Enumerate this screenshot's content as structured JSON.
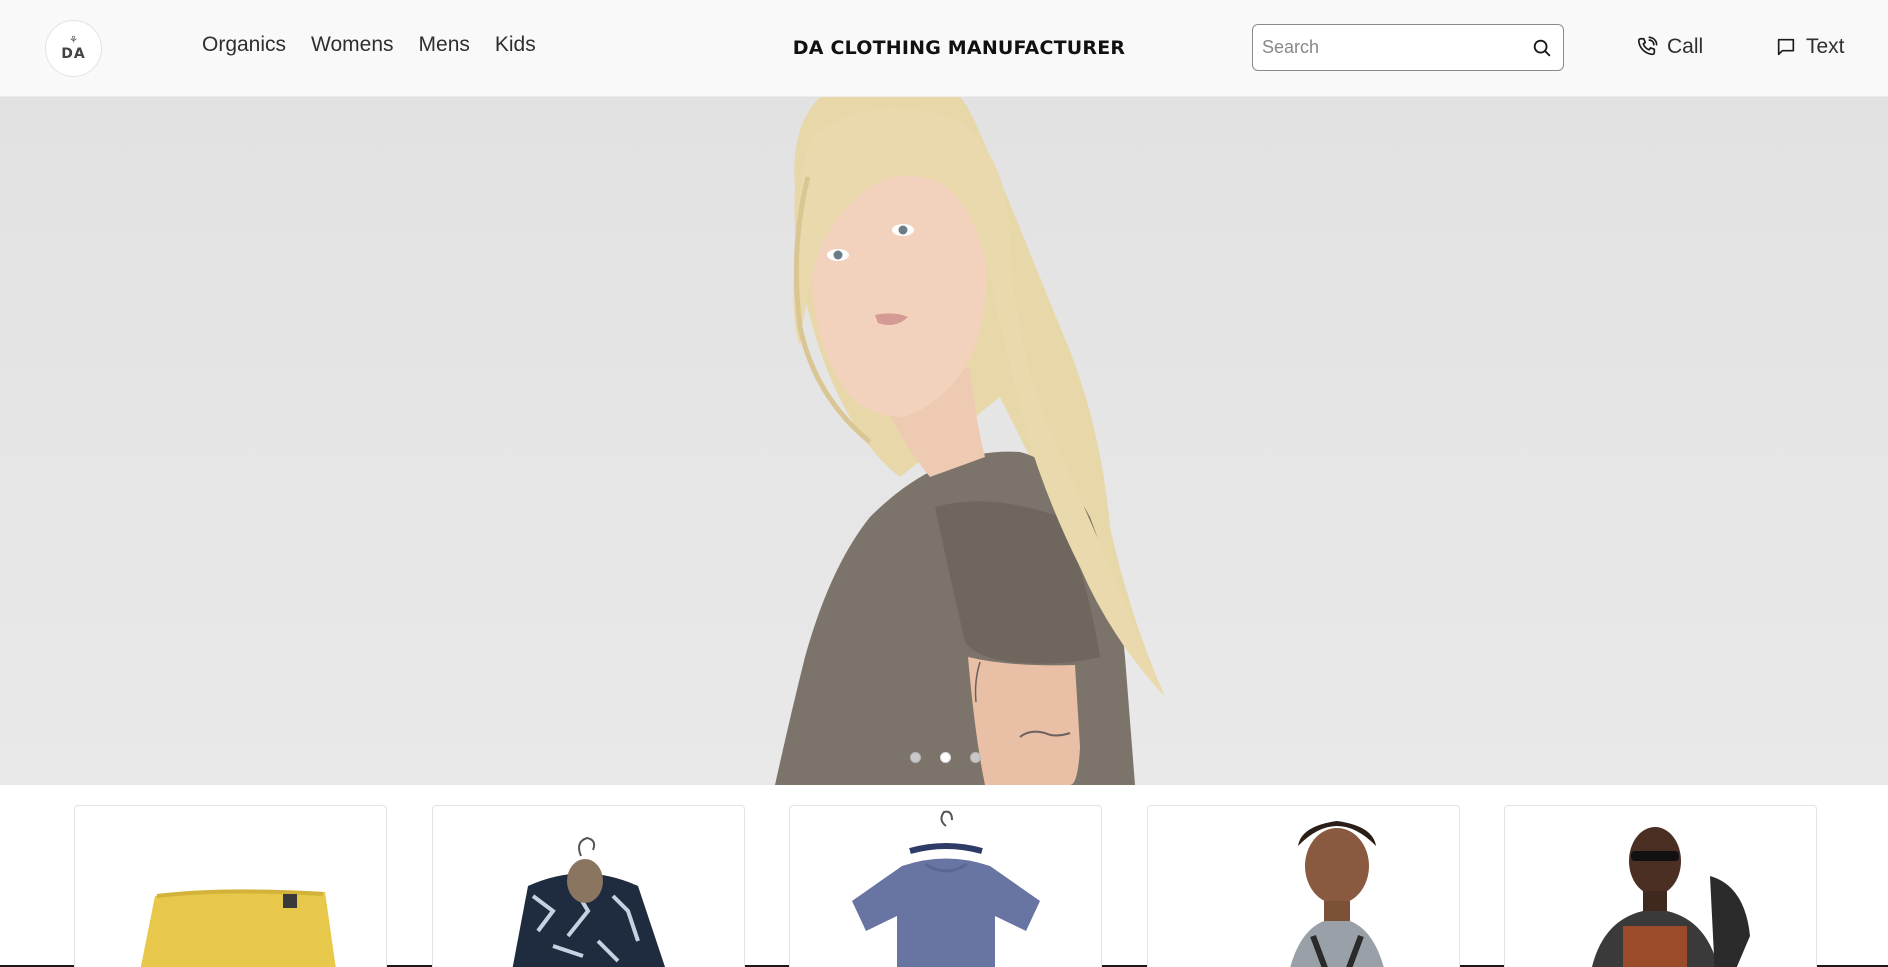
{
  "header": {
    "logo_mark": "⚘",
    "logo_text": "DA",
    "brand": "DA CLOTHING MANUFACTURER",
    "nav": [
      {
        "label": "Organics"
      },
      {
        "label": "Womens"
      },
      {
        "label": "Mens"
      },
      {
        "label": "Kids"
      }
    ],
    "search": {
      "placeholder": "Search",
      "value": ""
    },
    "call_label": "Call",
    "text_label": "Text"
  },
  "hero": {
    "slides": 3,
    "active_slide": 2
  },
  "products": [
    {
      "icon": "yellow-shorts-image"
    },
    {
      "icon": "patterned-jacket-image"
    },
    {
      "icon": "blue-tshirt-image"
    },
    {
      "icon": "tank-top-model-image"
    },
    {
      "icon": "graphic-tee-model-image"
    }
  ],
  "colors": {
    "header_bg": "#f9f9f9",
    "hero_bg": "#e4e4e4",
    "text": "#2f2f2f"
  }
}
